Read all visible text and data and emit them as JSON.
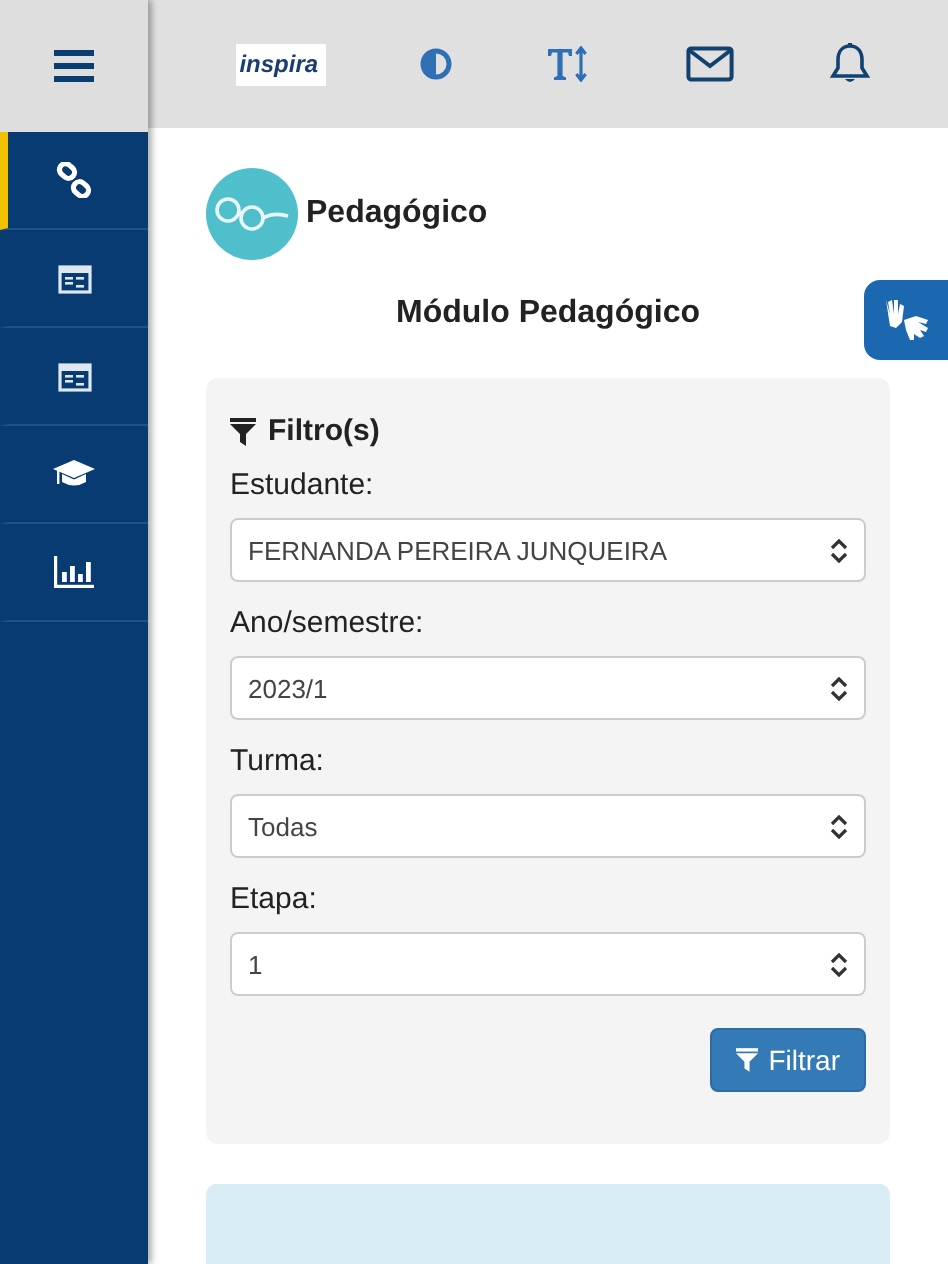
{
  "sidebar": {
    "items": [
      {
        "kind": "link",
        "selected": true
      },
      {
        "kind": "calendar",
        "selected": false
      },
      {
        "kind": "calendar",
        "selected": false
      },
      {
        "kind": "graduation",
        "selected": false
      },
      {
        "kind": "chart",
        "selected": false
      }
    ]
  },
  "topbar": {
    "logo": "inspira"
  },
  "module": {
    "name": "Pedagógico",
    "title": "Módulo Pedagógico"
  },
  "filter": {
    "heading": "Filtro(s)",
    "fields": [
      {
        "label": "Estudante:",
        "value": "FERNANDA PEREIRA JUNQUEIRA"
      },
      {
        "label": "Ano/semestre:",
        "value": "2023/1"
      },
      {
        "label": "Turma:",
        "value": "Todas"
      },
      {
        "label": "Etapa:",
        "value": "1"
      }
    ],
    "button": "Filtrar"
  }
}
